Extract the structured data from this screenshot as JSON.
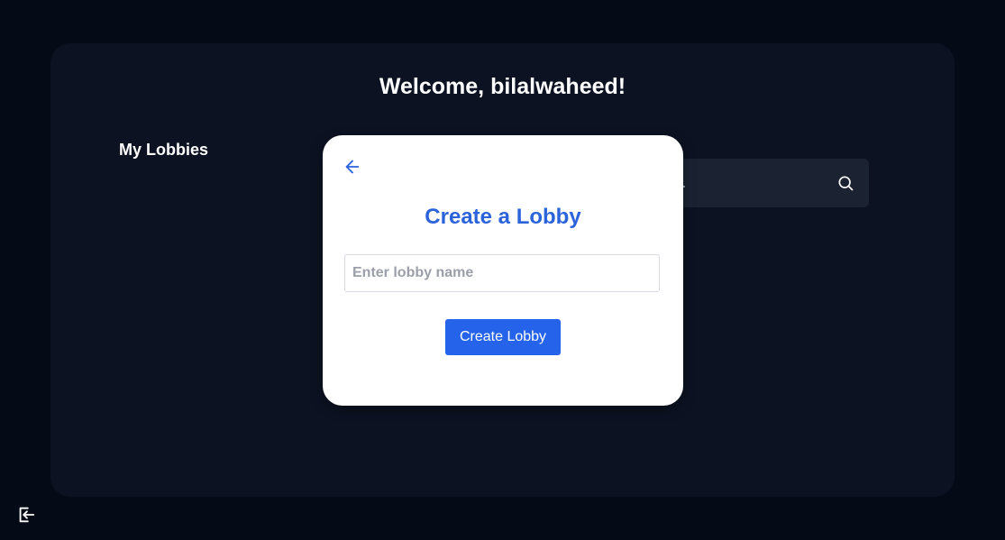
{
  "header": {
    "welcome": "Welcome, bilalwaheed!"
  },
  "sidebar": {
    "my_lobbies_label": "My Lobbies"
  },
  "search": {
    "placeholder": "Search lobbies...",
    "icon": "search-icon"
  },
  "modal": {
    "title": "Create a Lobby",
    "input_placeholder": "Enter lobby name",
    "create_label": "Create Lobby",
    "back_icon": "arrow-left-icon"
  },
  "footer": {
    "logout_icon": "logout-icon"
  },
  "colors": {
    "page_bg": "#050a17",
    "panel_bg": "#0c1222",
    "search_bg": "#1b2333",
    "accent": "#2563eb",
    "title_blue": "#2b63db"
  }
}
